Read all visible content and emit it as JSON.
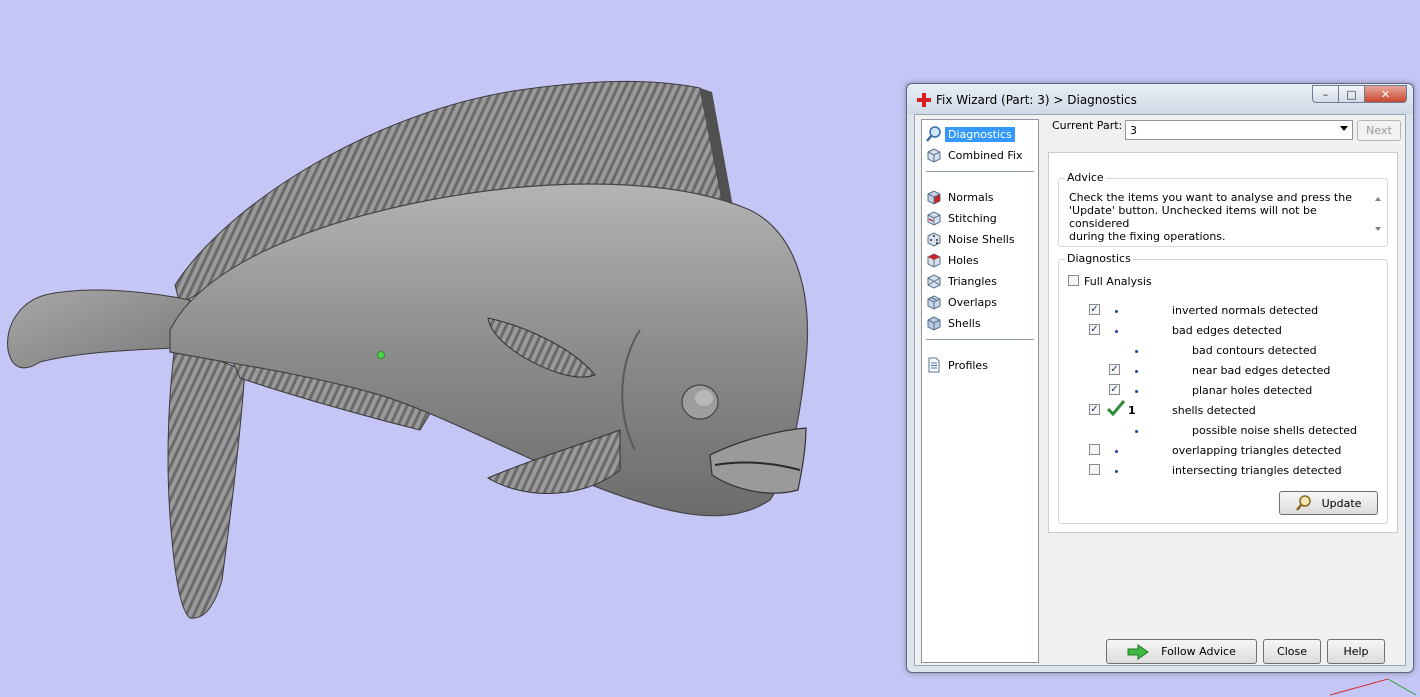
{
  "window": {
    "title": "Fix Wizard (Part: 3) > Diagnostics",
    "caption_buttons": {
      "minimize": "–",
      "maximize": "□",
      "close": "✕"
    }
  },
  "nav": {
    "items": [
      {
        "id": "diagnostics",
        "label": "Diagnostics",
        "icon": "magnifier-icon",
        "selected": true
      },
      {
        "id": "combined-fix",
        "label": "Combined Fix",
        "icon": "cube-icon"
      },
      {
        "id": "normals",
        "label": "Normals",
        "icon": "cube-red-face-icon"
      },
      {
        "id": "stitching",
        "label": "Stitching",
        "icon": "cube-stitch-icon"
      },
      {
        "id": "noise-shells",
        "label": "Noise Shells",
        "icon": "dice-icon"
      },
      {
        "id": "holes",
        "label": "Holes",
        "icon": "cube-hole-icon"
      },
      {
        "id": "triangles",
        "label": "Triangles",
        "icon": "triangle-cube-icon"
      },
      {
        "id": "overlaps",
        "label": "Overlaps",
        "icon": "overlap-cube-icon"
      },
      {
        "id": "shells",
        "label": "Shells",
        "icon": "shell-cube-icon"
      },
      {
        "id": "profiles",
        "label": "Profiles",
        "icon": "document-icon"
      }
    ]
  },
  "current_part": {
    "label": "Current Part:",
    "value": "3"
  },
  "buttons": {
    "next": "Next",
    "update": "Update",
    "follow_advice": "Follow Advice",
    "close": "Close",
    "help": "Help"
  },
  "advice": {
    "title": "Advice",
    "lines": [
      "Check the items you want to analyse and press the",
      "'Update' button. Unchecked items will not be considered",
      "during the fixing operations."
    ]
  },
  "diagnostics": {
    "title": "Diagnostics",
    "full_analysis": {
      "label": "Full Analysis",
      "checked": false
    },
    "rows": [
      {
        "label": "inverted normals detected",
        "checked": true,
        "level": 0,
        "has_checkbox": true,
        "status": "",
        "count": ""
      },
      {
        "label": "bad edges detected",
        "checked": true,
        "level": 0,
        "has_checkbox": true,
        "status": "",
        "count": ""
      },
      {
        "label": "bad contours detected",
        "checked": false,
        "level": 1,
        "has_checkbox": false,
        "status": "",
        "count": ""
      },
      {
        "label": "near bad edges detected",
        "checked": true,
        "level": 1,
        "has_checkbox": true,
        "status": "",
        "count": ""
      },
      {
        "label": "planar holes detected",
        "checked": true,
        "level": 1,
        "has_checkbox": true,
        "status": "",
        "count": ""
      },
      {
        "label": "shells detected",
        "checked": true,
        "level": 0,
        "has_checkbox": true,
        "status": "ok",
        "count": "1"
      },
      {
        "label": "possible noise shells detected",
        "checked": false,
        "level": 1,
        "has_checkbox": false,
        "status": "",
        "count": ""
      },
      {
        "label": "overlapping triangles detected",
        "checked": false,
        "level": 0,
        "has_checkbox": true,
        "status": "",
        "count": ""
      },
      {
        "label": "intersecting triangles detected",
        "checked": false,
        "level": 0,
        "has_checkbox": true,
        "status": "",
        "count": ""
      }
    ]
  },
  "colors": {
    "viewport_bg": "#c6c6f6",
    "model": "#8f8f8f",
    "selection": "#3399ff",
    "ok_check": "#2e8b3a",
    "bullet": "#1f3fa0"
  }
}
